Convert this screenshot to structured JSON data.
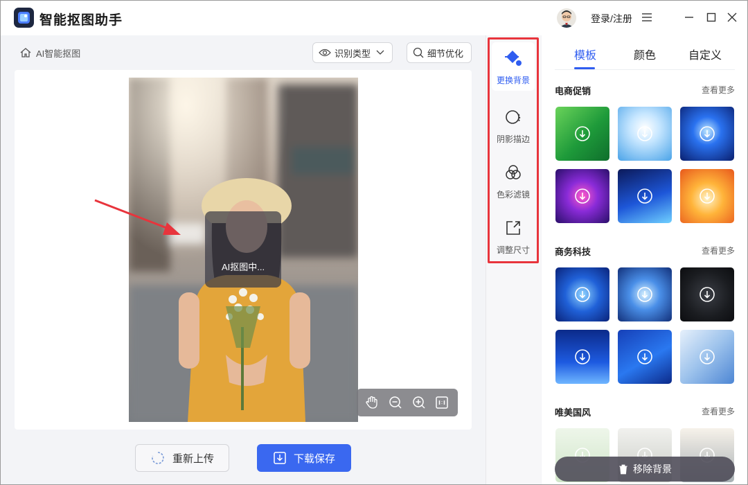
{
  "app": {
    "title": "智能抠图助手",
    "login_label": "登录/注册"
  },
  "breadcrumb": {
    "label": "AI智能抠图"
  },
  "toolbar_top": {
    "recognize_type": "识别类型",
    "detail_optimize": "细节优化"
  },
  "canvas": {
    "processing_text": "AI抠图中..."
  },
  "actions": {
    "reupload": "重新上传",
    "download": "下载保存"
  },
  "side_tools": [
    {
      "label": "更换背景",
      "icon": "paint-bucket-icon",
      "active": true
    },
    {
      "label": "阴影描边",
      "icon": "shadow-outline-icon",
      "active": false
    },
    {
      "label": "色彩滤镜",
      "icon": "color-filter-icon",
      "active": false
    },
    {
      "label": "调整尺寸",
      "icon": "resize-icon",
      "active": false
    }
  ],
  "panel": {
    "tabs": [
      "模板",
      "颜色",
      "自定义"
    ],
    "active_tab": "模板",
    "sections": [
      {
        "title": "电商促销",
        "more": "查看更多"
      },
      {
        "title": "商务科技",
        "more": "查看更多"
      },
      {
        "title": "唯美国风",
        "more": "查看更多"
      }
    ],
    "remove_bg": "移除背景"
  },
  "colors": {
    "accent": "#2f5df0",
    "highlight": "#e8343c"
  }
}
